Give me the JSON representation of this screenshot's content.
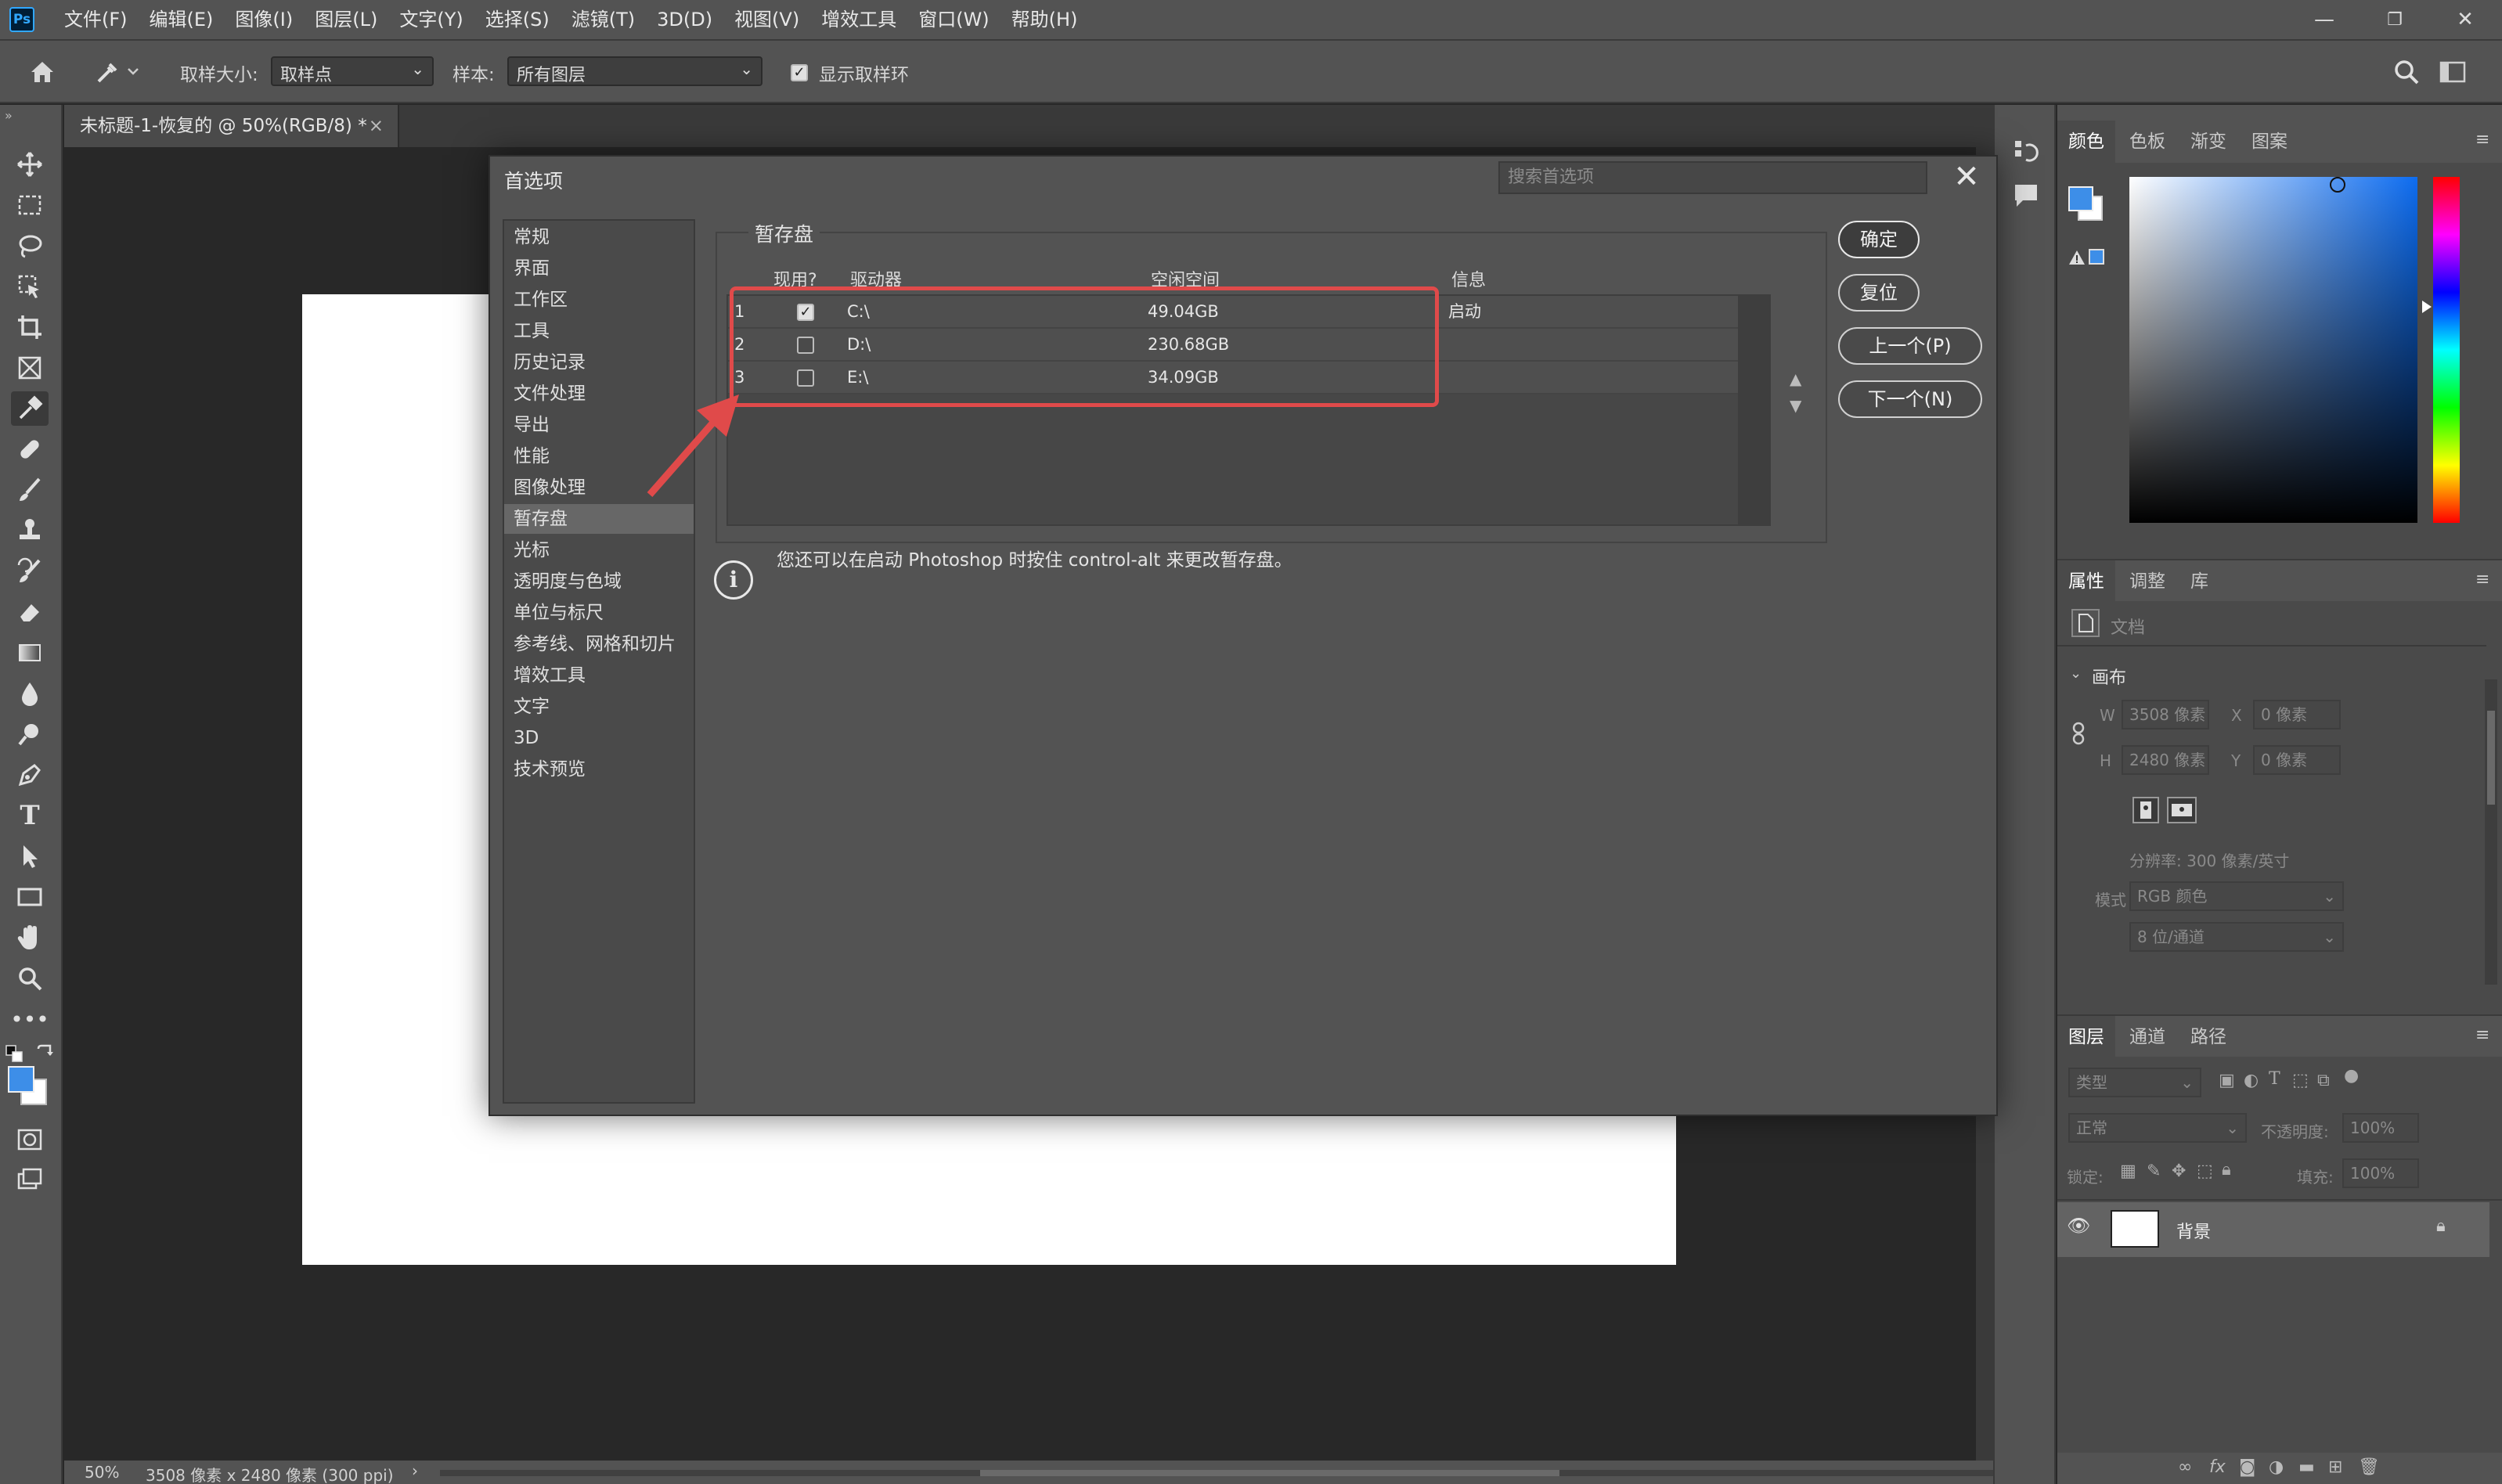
{
  "app": {
    "logo": "Ps"
  },
  "menubar": {
    "items": [
      "文件(F)",
      "编辑(E)",
      "图像(I)",
      "图层(L)",
      "文字(Y)",
      "选择(S)",
      "滤镜(T)",
      "3D(D)",
      "视图(V)",
      "增效工具",
      "窗口(W)",
      "帮助(H)"
    ]
  },
  "window": {
    "minimize": "—",
    "maximize": "❐",
    "close": "✕"
  },
  "options": {
    "sample_size_label": "取样大小:",
    "sample_size_value": "取样点",
    "sample_label": "样本:",
    "sample_value": "所有图层",
    "show_ring_label": "显示取样环",
    "show_ring_checked": true
  },
  "document": {
    "tab_title": "未标题-1-恢复的 @ 50%(RGB/8) *",
    "tab_close": "×"
  },
  "status": {
    "zoom": "50%",
    "info": "3508 像素 x 2480 像素 (300 ppi)",
    "arrow": "›"
  },
  "dialog": {
    "title": "首选项",
    "search_placeholder": "搜索首选项",
    "close": "✕",
    "nav": [
      "常规",
      "界面",
      "工作区",
      "工具",
      "历史记录",
      "文件处理",
      "导出",
      "性能",
      "图像处理",
      "暂存盘",
      "光标",
      "透明度与色域",
      "单位与标尺",
      "参考线、网格和切片",
      "增效工具",
      "文字",
      "3D",
      "技术预览"
    ],
    "nav_selected": "暂存盘",
    "section_title": "暂存盘",
    "columns": {
      "active": "现用?",
      "drive": "驱动器",
      "free": "空闲空间",
      "info": "信息"
    },
    "drives": [
      {
        "num": "1",
        "active": true,
        "drive": "C:\\",
        "free": "49.04GB",
        "info": "启动"
      },
      {
        "num": "2",
        "active": false,
        "drive": "D:\\",
        "free": "230.68GB",
        "info": ""
      },
      {
        "num": "3",
        "active": false,
        "drive": "E:\\",
        "free": "34.09GB",
        "info": ""
      }
    ],
    "buttons": {
      "ok": "确定",
      "reset": "复位",
      "prev": "上一个(P)",
      "next": "下一个(N)"
    },
    "note": "您还可以在启动 Photoshop 时按住 control-alt 来更改暂存盘。",
    "move_up": "▲",
    "move_down": "▼"
  },
  "panels": {
    "color_tabs": [
      "颜色",
      "色板",
      "渐变",
      "图案"
    ],
    "prop_tabs": [
      "属性",
      "调整",
      "库"
    ],
    "doc_label": "文档",
    "canvas_label": "画布",
    "w_label": "W",
    "w_value": "3508 像素",
    "h_label": "H",
    "h_value": "2480 像素",
    "x_label": "X",
    "x_value": "0 像素",
    "y_label": "Y",
    "y_value": "0 像素",
    "resolution": "分辨率: 300 像素/英寸",
    "mode_label": "模式",
    "mode_value": "RGB 颜色",
    "depth_value": "8 位/通道",
    "layer_tabs": [
      "图层",
      "通道",
      "路径"
    ],
    "kind_placeholder": "类型",
    "blend_mode": "正常",
    "opacity_label": "不透明度:",
    "opacity_value": "100%",
    "lock_label": "锁定:",
    "fill_label": "填充:",
    "fill_value": "100%",
    "layer_name": "背景"
  },
  "colors": {
    "accent": "#e04a4a",
    "foreground": "#3d8ee8",
    "background": "#ffffff"
  }
}
